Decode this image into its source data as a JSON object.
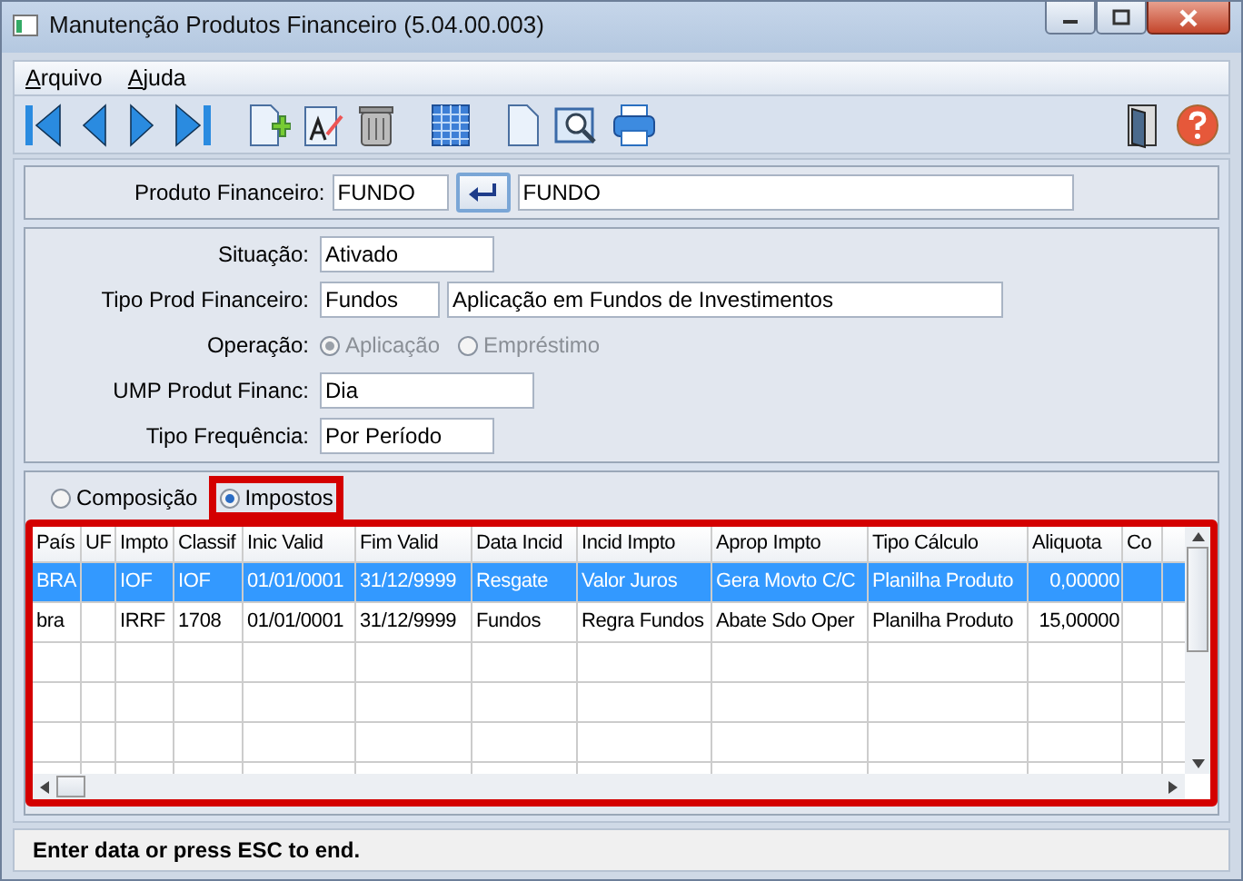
{
  "window": {
    "title": "Manutenção Produtos Financeiro (5.04.00.003)"
  },
  "menu": [
    "Arquivo",
    "Ajuda"
  ],
  "product": {
    "label": "Produto Financeiro:",
    "code": "FUNDO",
    "description": "FUNDO"
  },
  "details": [
    {
      "kind": "text",
      "label": "Situação:",
      "value": "Ativado"
    },
    {
      "kind": "pair",
      "label": "Tipo Prod Financeiro:",
      "value": "Fundos",
      "description": "Aplicação em Fundos de Investimentos"
    },
    {
      "kind": "radios",
      "label": "Operação:",
      "disabled": true,
      "options": [
        {
          "label": "Aplicação",
          "selected": true
        },
        {
          "label": "Empréstimo",
          "selected": false
        }
      ]
    },
    {
      "kind": "text",
      "label": "UMP Produt Financ:",
      "value": "Dia"
    },
    {
      "kind": "text",
      "label": "Tipo Frequência:",
      "value": "Por Período"
    }
  ],
  "tabs": [
    {
      "label": "Composição",
      "selected": false,
      "highlighted": false
    },
    {
      "label": "Impostos",
      "selected": true,
      "highlighted": true
    }
  ],
  "table": {
    "highlighted": true,
    "columns": [
      "País",
      "UF",
      "Impto",
      "Classif",
      "Inic Valid",
      "Fim Valid",
      "Data Incid",
      "Incid Impto",
      "Aprop Impto",
      "Tipo Cálculo",
      "Aliquota",
      "Co"
    ],
    "rows": [
      {
        "selected": true,
        "cells": [
          "BRA",
          "",
          "IOF",
          "IOF",
          "01/01/0001",
          "31/12/9999",
          "Resgate",
          "Valor Juros",
          "Gera Movto C/C",
          "Planilha Produto",
          "0,00000",
          ""
        ]
      },
      {
        "selected": false,
        "cells": [
          "bra",
          "",
          "IRRF",
          "1708",
          "01/01/0001",
          "31/12/9999",
          "Fundos",
          "Regra Fundos",
          "Abate Sdo Oper",
          "Planilha Produto",
          "15,00000",
          ""
        ]
      }
    ]
  },
  "status_bar": "Enter data or press ESC to end."
}
